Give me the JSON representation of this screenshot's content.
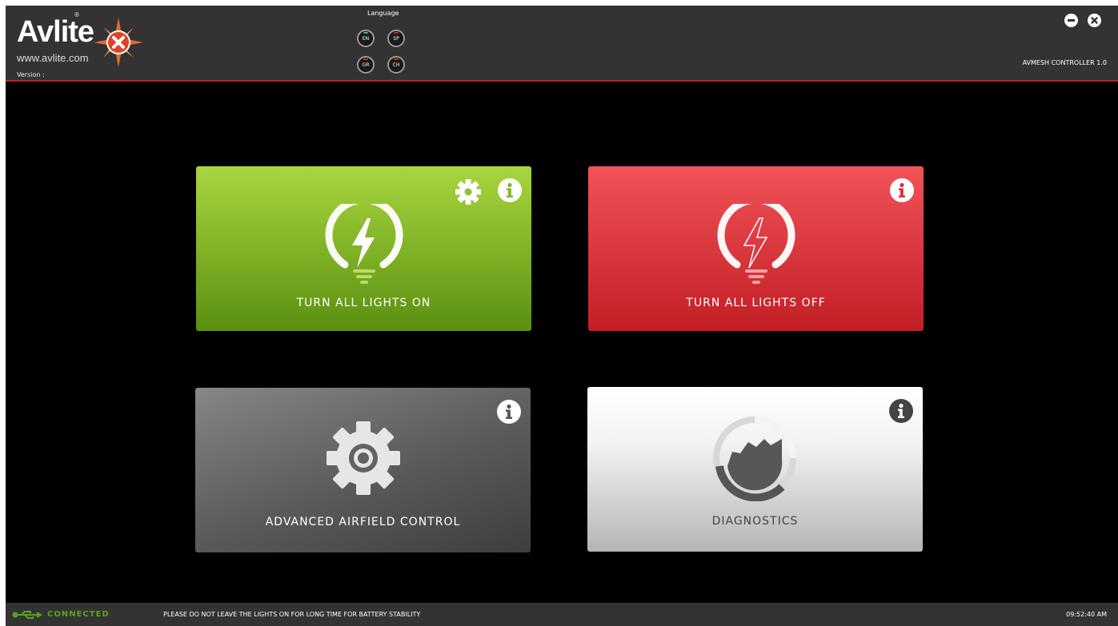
{
  "header": {
    "logo_word": "Avlite",
    "logo_reg": "®",
    "logo_url": "www.avlite.com",
    "version_label": "Version :",
    "app_name": "AVMESH CONTROLLER 1.0",
    "minimize_icon": "minimize-icon",
    "close_icon": "close-icon"
  },
  "language": {
    "title": "Language",
    "options": [
      {
        "code": "EN",
        "active": true,
        "indicator_color": "#3fbf3f"
      },
      {
        "code": "SP",
        "active": false,
        "indicator_color": "#d12a2a"
      },
      {
        "code": "GR",
        "active": false,
        "indicator_color": "#d12a2a"
      },
      {
        "code": "CH",
        "active": false,
        "indicator_color": "#d12a2a"
      }
    ]
  },
  "tiles": {
    "lights_on": {
      "label": "TURN ALL LIGHTS ON",
      "icon": "lightbulb-bolt-icon",
      "color": "#7fb52b"
    },
    "lights_off": {
      "label": "TURN ALL LIGHTS OFF",
      "icon": "lightbulb-bolt-outline-icon",
      "color": "#dd2f35"
    },
    "advanced": {
      "label": "ADVANCED AIRFIELD CONTROL",
      "icon": "gear-icon",
      "color": "#5a5a5a"
    },
    "diagnostics": {
      "label": "DIAGNOSTICS",
      "icon": "diagnostics-gauge-icon",
      "color": "#e0e0e0"
    }
  },
  "status": {
    "connection": "CONNECTED",
    "connection_color": "#5aa221",
    "message": "PLEASE DO NOT LEAVE THE LIGHTS ON FOR LONG TIME FOR BATTERY STABILITY",
    "time": "09:52:40 AM"
  }
}
